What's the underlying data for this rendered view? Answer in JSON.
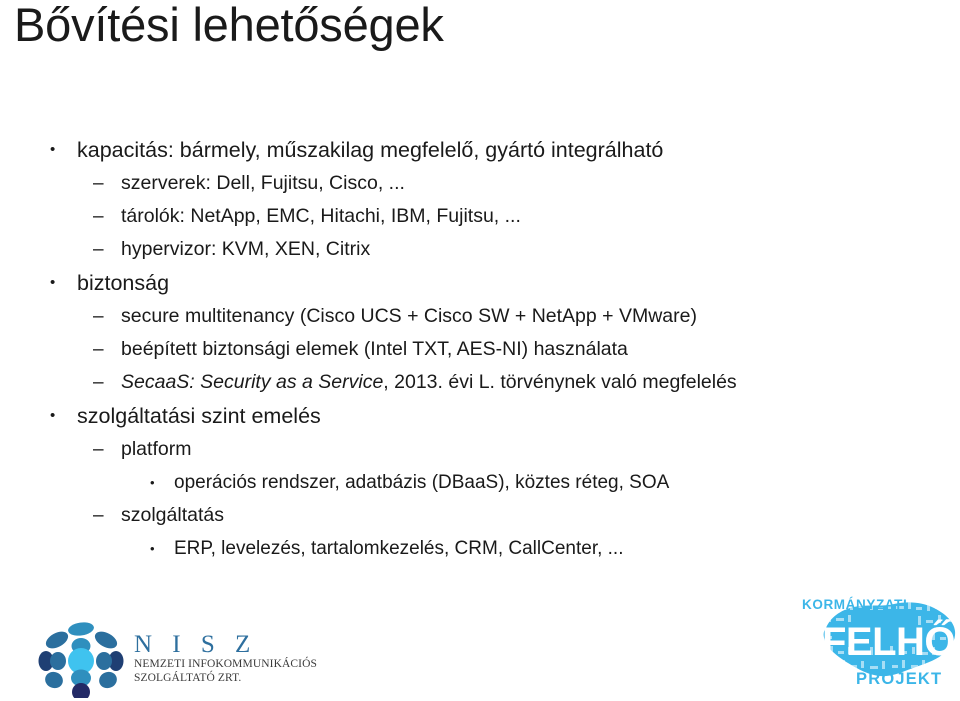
{
  "slide": {
    "title": "Bővítési lehetőségek",
    "background_color": "#ffffff",
    "text_color": "#1a1a1a"
  },
  "content": {
    "bullets": [
      {
        "level": 1,
        "marker": "•",
        "text": "kapacitás: bármely, műszakilag megfelelő, gyártó integrálható"
      },
      {
        "level": 2,
        "marker": "–",
        "text": "szerverek: Dell, Fujitsu, Cisco, ..."
      },
      {
        "level": 2,
        "marker": "–",
        "text": "tárolók: NetApp, EMC, Hitachi, IBM, Fujitsu, ..."
      },
      {
        "level": 2,
        "marker": "–",
        "text": "hypervizor: KVM, XEN, Citrix"
      },
      {
        "level": 1,
        "marker": "•",
        "text": "biztonság"
      },
      {
        "level": 2,
        "marker": "–",
        "text": "secure multitenancy (Cisco UCS + Cisco SW + NetApp + VMware)"
      },
      {
        "level": 2,
        "marker": "–",
        "text": "beépített biztonsági elemek (Intel TXT, AES-NI) használata"
      },
      {
        "level": 2,
        "marker": "–",
        "italic_lead": "SecaaS: Security as a Service",
        "text": ", 2013. évi L. törvénynek való megfelelés"
      },
      {
        "level": 1,
        "marker": "•",
        "text": "szolgáltatási szint emelés"
      },
      {
        "level": 2,
        "marker": "–",
        "text": "platform"
      },
      {
        "level": 3,
        "marker": "•",
        "text": "operációs rendszer, adatbázis (DBaaS), köztes réteg, SOA"
      },
      {
        "level": 2,
        "marker": "–",
        "text": "szolgáltatás"
      },
      {
        "level": 3,
        "marker": "•",
        "text": "ERP, levelezés, tartalomkezelés, CRM, CallCenter, ..."
      }
    ]
  },
  "logos": {
    "nisz": {
      "name": "N I S Z",
      "subtitle_line1": "NEMZETI INFOKOMMUNIKÁCIÓS",
      "subtitle_line2": "SZOLGÁLTATÓ ZRT.",
      "name_color": "#2e6f9e",
      "subtitle_color": "#3a3a3a",
      "mark_colors": {
        "center": "#3fc3ef",
        "mid": "#2f8fbe",
        "ring": "#2b6f9e",
        "dark": "#1f3f73",
        "deep": "#232a66"
      }
    },
    "felho": {
      "top_text": "KORMÁNYZATI",
      "word": "FELHŐ",
      "bottom_text": "PROJEKT",
      "color": "#3cb6e8"
    }
  }
}
